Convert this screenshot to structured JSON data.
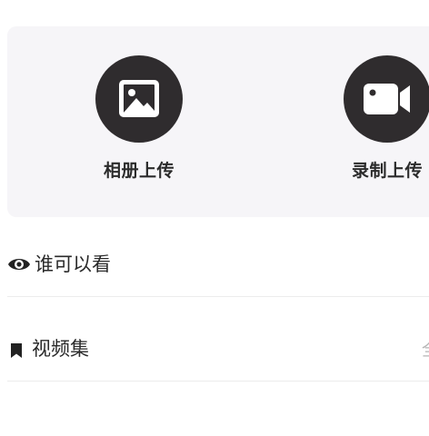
{
  "upload": {
    "album_label": "相册上传",
    "record_label": "录制上传"
  },
  "settings": {
    "privacy_label": "谁可以看",
    "collection_label": "视频集",
    "collection_value": "全"
  },
  "icons": {
    "album": "image-icon",
    "record": "video-camera-icon",
    "privacy": "eye-icon",
    "collection": "bookmark-icon"
  },
  "colors": {
    "card_background": "#f6f5f8",
    "icon_circle": "#2f2c2e",
    "value_text": "#b5b5b5"
  }
}
